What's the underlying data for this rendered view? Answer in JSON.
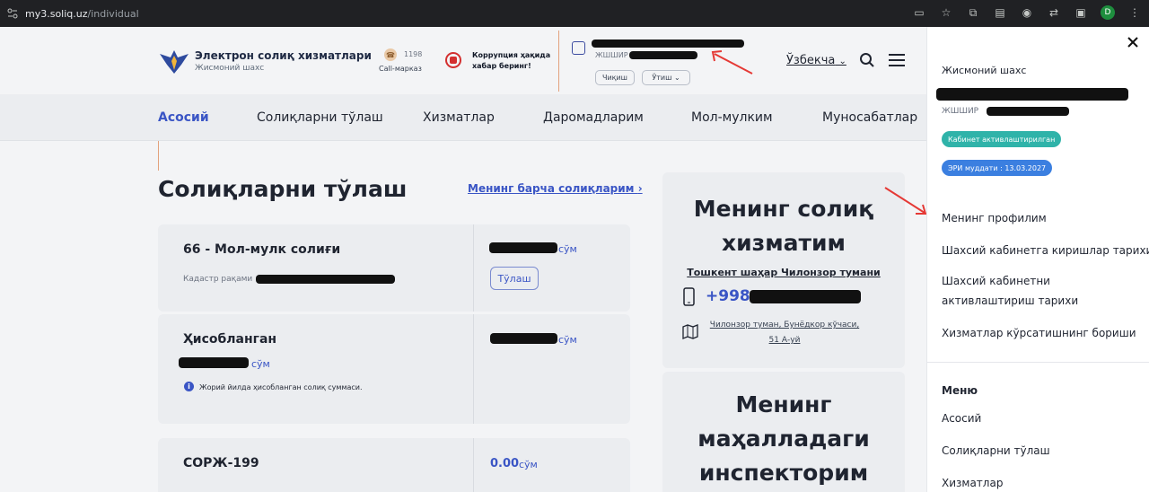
{
  "browser": {
    "url_host": "my3.soliq.uz",
    "url_path": "/individual",
    "avatar_letter": "D"
  },
  "header": {
    "site_title": "Электрон солиқ хизматлари",
    "site_subtitle": "Жисмоний шахс",
    "call_number": "1198",
    "call_label": "Call-марказ",
    "corruption_text": "Коррупция ҳақида хабар беринг!",
    "jshshir_label": "ЖШШИР",
    "logout_label": "Чиқиш",
    "switch_label": "Ўтиш",
    "language": "Ўзбекча"
  },
  "nav": {
    "items": [
      {
        "label": "Асосий"
      },
      {
        "label": "Солиқларни тўлаш"
      },
      {
        "label": "Хизматлар"
      },
      {
        "label": "Даромадларим"
      },
      {
        "label": "Мол-мулким"
      },
      {
        "label": "Муносабатлар"
      }
    ]
  },
  "main": {
    "title": "Солиқларни тўлаш",
    "all_taxes_link": "Менинг барча солиқларим",
    "card1": {
      "title": "66 - Мол-мулк солиғи",
      "cadastre_label": "Кадастр рақами",
      "currency": "сўм",
      "pay_label": "Тўлаш"
    },
    "card2": {
      "title": "Ҳисобланган",
      "currency": "сўм",
      "info": "Жорий йилда ҳисобланган солиқ суммаси."
    },
    "card3": {
      "title": "СОРЖ-199",
      "amount": "0.00",
      "currency": "сўм"
    }
  },
  "side": {
    "title_line1": "Менинг солиқ",
    "title_line2": "хизматим",
    "office": "Тошкент шаҳар Чилонзор тумани",
    "phone_prefix": "+998",
    "address_line1": "Чилонзор туман, Бунёдкор кўчаси,",
    "address_line2": "51 А-уй",
    "title2_line1": "Менинг",
    "title2_line2": "маҳалладаги",
    "title2_line3": "инспекторим"
  },
  "panel": {
    "person_type": "Жисмоний шахс",
    "jshshir_label": "ЖШШИР",
    "badge_active": "Кабинет активлаштирилган",
    "badge_eri": "ЭРИ муддати : 13.03.2027",
    "links": [
      "Менинг профилим",
      "Шахсий кабинетга киришлар тарихи",
      "Шахсий кабинетни активлаштириш тарихи",
      "Хизматлар кўрсатишнинг бориши"
    ],
    "menu_heading": "Меню",
    "menu_items": [
      "Асосий",
      "Солиқларни тўлаш",
      "Хизматлар"
    ]
  },
  "colors": {
    "accent": "#3a55c5",
    "badge_green": "#2fb3a9",
    "badge_blue": "#3b7fe0",
    "annotation": "#e53935"
  }
}
